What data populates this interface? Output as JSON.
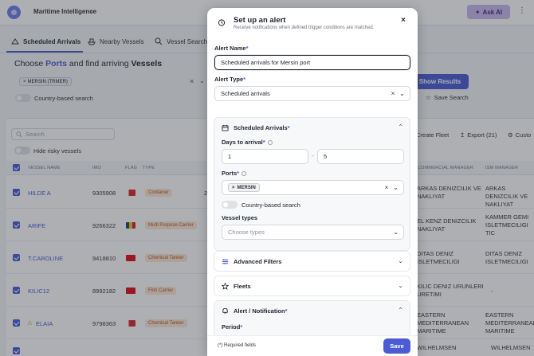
{
  "app": {
    "title": "Maritime Intelligence",
    "ask_ai": "Ask AI"
  },
  "tabs": [
    "Scheduled Arrivals",
    "Nearby Vessels",
    "Vessel Search"
  ],
  "search_header": {
    "choose": "Choose",
    "ports": "Ports",
    "middle": "and find arriving",
    "vessels": "Vessels"
  },
  "port_chip": "MERSIN (TRMER)",
  "country_search": "Country-based search",
  "show_results": "Show Results",
  "save_search": "Save Search",
  "table_search_placeholder": "Search",
  "hide_risky": "Hide risky vessels",
  "toolbar": {
    "create_fleet": "Create Fleet",
    "export": "Export (21)",
    "custom": "Custo"
  },
  "columns": [
    "VESSEL NAME",
    "IMO",
    "FLAG",
    "TYPE",
    "COMMERCIAL MANAGER",
    "ISM MANAGER"
  ],
  "rows": [
    {
      "name": "HILDE A",
      "imo": "9305908",
      "type": "Container",
      "cm": "ARKAS DENIZCILIK VE NAKLIYAT",
      "ism": "ARKAS DENIZCILIK VE NAKLIYAT",
      "col2": "2"
    },
    {
      "name": "ARIFE",
      "imo": "9266322",
      "type": "Multi Purpose Carrier",
      "cm": "EL KENZ DENIZCILIK NAKLIYAT",
      "ism": "KAMMER GEMI ISLETMECILIGI TIC",
      "col2": ""
    },
    {
      "name": "T.CAROLINE",
      "imo": "9418810",
      "type": "Chemical Tanker",
      "cm": "DITAS DENIZ ISLETMECILIGI",
      "ism": "DITAS DENIZ ISLETMECILIGI",
      "col2": ""
    },
    {
      "name": "KILIC12",
      "imo": "8992182",
      "type": "Fish Carrier",
      "cm": "KILIC DENIZ URUNLERI URETIMI",
      "ism": "-",
      "col2": ""
    },
    {
      "name": "ELAIA",
      "imo": "9798363",
      "type": "Chemical Tanker",
      "cm": "EASTERN MEDITERRANEAN MARITIME",
      "ism": "EASTERN MEDITERRANEAN MARITIME",
      "col2": ""
    },
    {
      "name": "",
      "imo": "",
      "type": "",
      "cm": "WILHELMSEN",
      "ism": "WILHELMSEN",
      "col2": ""
    }
  ],
  "modal": {
    "title": "Set up an alert",
    "subtitle": "Receive notifications when defined trigger conditions are matched.",
    "alert_name_label": "Alert Name",
    "alert_name_value": "Scheduled arrivals for Mersin port",
    "alert_type_label": "Alert Type",
    "alert_type_value": "Scheduled arrivals",
    "sections": {
      "scheduled": "Scheduled Arrivals",
      "advanced": "Advanced Filters",
      "fleets": "Fleets",
      "alert": "Alert / Notification"
    },
    "days_label": "Days to arrival",
    "days_from": "1",
    "days_sep": "-",
    "days_to": "5",
    "ports_label": "Ports",
    "port_chip": "MERSIN",
    "country_search": "Country-based search",
    "vessel_types_label": "Vessel types",
    "vessel_types_placeholder": "Choose types",
    "period_label": "Period",
    "required_note": "(*) Required fields",
    "save": "Save",
    "required_mark": "*"
  },
  "colors": {
    "accent": "#4a5bd4",
    "tag_bg": "#fde7d4",
    "tag_text": "#b4541b"
  }
}
